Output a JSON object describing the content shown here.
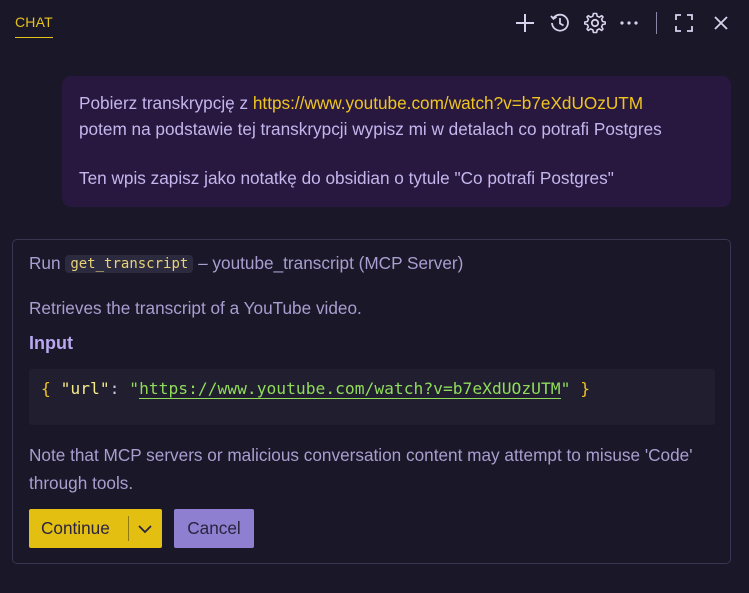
{
  "header": {
    "tab_label": "CHAT",
    "icons": [
      "plus-icon",
      "history-icon",
      "gear-icon",
      "more-icon",
      "maximize-icon",
      "close-icon"
    ]
  },
  "message": {
    "line1_text": "Pobierz transkrypcję z ",
    "line1_link": "https://www.youtube.com/watch?v=b7eXdUOzUTM",
    "line2": "potem na podstawie tej transkrypcji wypisz mi w detalach co potrafi Postgres",
    "line3": "Ten wpis zapisz jako notatkę do obsidian o tytule \"Co potrafi Postgres\""
  },
  "tool": {
    "run_prefix": "Run",
    "tool_name": "get_transcript",
    "server_suffix": " – youtube_transcript (MCP Server)",
    "description": "Retrieves the transcript of a YouTube video.",
    "input_heading": "Input",
    "input_open": "{",
    "input_key": "\"url\"",
    "input_colon": ":",
    "input_quote_open": "\"",
    "input_value": "https://www.youtube.com/watch?v=b7eXdUOzUTM",
    "input_quote_close": "\"",
    "input_close": "}",
    "note": "Note that MCP servers or malicious conversation content may attempt to misuse 'Code' through tools.",
    "continue_label": "Continue",
    "cancel_label": "Cancel"
  },
  "colors": {
    "background": "#1a1728",
    "accent_yellow": "#e3bf12",
    "message_bg": "#28183f",
    "cancel_bg": "#8f7fd0"
  }
}
